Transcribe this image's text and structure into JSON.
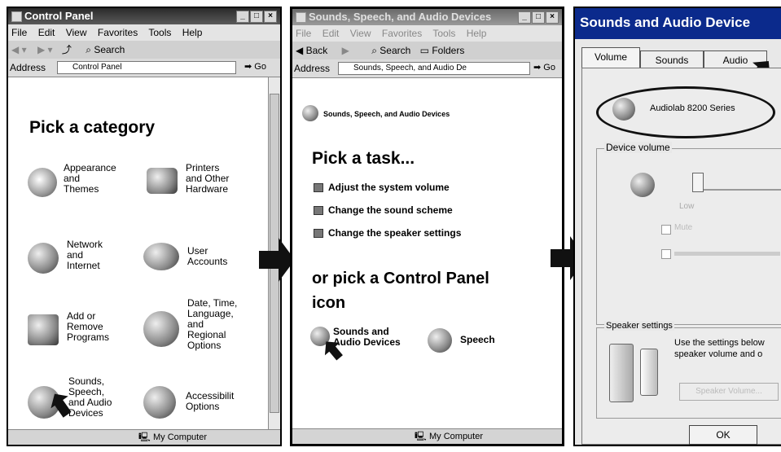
{
  "panel1": {
    "title": "Control Panel",
    "menu": [
      "File",
      "Edit",
      "View",
      "Favorites",
      "Tools",
      "Help"
    ],
    "toolbar_search": "Search",
    "address_label": "Address",
    "address_value": "Control Panel",
    "go": "Go",
    "heading": "Pick a category",
    "categories": [
      {
        "label": "Appearance\nand\nThemes",
        "icon": "appearance-icon"
      },
      {
        "label": "Printers\nand Other\nHardware",
        "icon": "printer-icon"
      },
      {
        "label": "Network\nand\nInternet",
        "icon": "network-icon"
      },
      {
        "label": "User\nAccounts",
        "icon": "users-icon"
      },
      {
        "label": "Add or\nRemove\nPrograms",
        "icon": "programs-icon"
      },
      {
        "label": "Date, Time,\nLanguage,\nand\nRegional\nOptions",
        "icon": "globe-icon"
      },
      {
        "label": "Sounds,\nSpeech,\nand Audio\nDevices",
        "icon": "sounds-icon"
      },
      {
        "label": "Accessibilit\nOptions",
        "icon": "accessibility-icon"
      }
    ],
    "status": "My Computer"
  },
  "panel2": {
    "title": "Sounds, Speech, and Audio Devices",
    "menu": [
      "File",
      "Edit",
      "View",
      "Favorites",
      "Tools",
      "Help"
    ],
    "toolbar_back": "Back",
    "toolbar_search": "Search",
    "toolbar_folders": "Folders",
    "address_label": "Address",
    "address_value": "Sounds, Speech, and Audio De",
    "go": "Go",
    "section_title": "Sounds, Speech, and Audio Devices",
    "task_heading": "Pick a task...",
    "tasks": [
      "Adjust the system volume",
      "Change the sound scheme",
      "Change the speaker settings"
    ],
    "icon_heading_1": "or pick a Control Panel",
    "icon_heading_2": "icon",
    "icons": [
      {
        "label": "Sounds and\nAudio Devices",
        "icon": "sounds-audio-icon"
      },
      {
        "label": "Speech",
        "icon": "speech-icon"
      }
    ],
    "status": "My Computer"
  },
  "panel3": {
    "title": "Sounds and Audio Device",
    "tabs": [
      "Volume",
      "Sounds",
      "Audio"
    ],
    "device_name": "Audiolab 8200 Series",
    "device_volume_label": "Device volume",
    "low_label": "Low",
    "mute_label": "Mute",
    "speaker_settings_label": "Speaker settings",
    "speaker_text": "Use the settings below\nspeaker volume and o",
    "speaker_volume_button": "Speaker Volume...",
    "ok_button": "OK"
  },
  "colors": {
    "arrow": "#111111",
    "titlebar3": "#0b2a8c"
  }
}
